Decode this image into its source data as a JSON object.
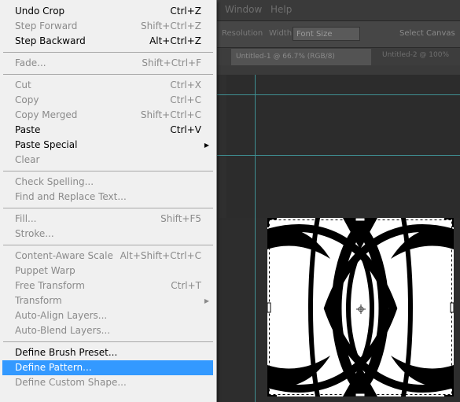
{
  "background_app": {
    "menubar": [
      "Window",
      "Help"
    ],
    "options_bar": {
      "label": "Resolution",
      "field1": "Width",
      "dropdown": "Font Size",
      "field2": "Select Canvas"
    },
    "doc_tab": {
      "title": "Untitled-1 @ 66.7% (RGB/8)",
      "second": "Untitled-2 @ 100%"
    }
  },
  "edit_menu": {
    "groups": [
      [
        {
          "label": "Undo Crop",
          "shortcut": "Ctrl+Z",
          "enabled": true
        },
        {
          "label": "Step Forward",
          "shortcut": "Shift+Ctrl+Z",
          "enabled": false
        },
        {
          "label": "Step Backward",
          "shortcut": "Alt+Ctrl+Z",
          "enabled": true
        }
      ],
      [
        {
          "label": "Fade...",
          "shortcut": "Shift+Ctrl+F",
          "enabled": false
        }
      ],
      [
        {
          "label": "Cut",
          "shortcut": "Ctrl+X",
          "enabled": false
        },
        {
          "label": "Copy",
          "shortcut": "Ctrl+C",
          "enabled": false
        },
        {
          "label": "Copy Merged",
          "shortcut": "Shift+Ctrl+C",
          "enabled": false
        },
        {
          "label": "Paste",
          "shortcut": "Ctrl+V",
          "enabled": true
        },
        {
          "label": "Paste Special",
          "shortcut": "",
          "enabled": true,
          "submenu": true
        },
        {
          "label": "Clear",
          "shortcut": "",
          "enabled": false
        }
      ],
      [
        {
          "label": "Check Spelling...",
          "shortcut": "",
          "enabled": false
        },
        {
          "label": "Find and Replace Text...",
          "shortcut": "",
          "enabled": false
        }
      ],
      [
        {
          "label": "Fill...",
          "shortcut": "Shift+F5",
          "enabled": false
        },
        {
          "label": "Stroke...",
          "shortcut": "",
          "enabled": false
        }
      ],
      [
        {
          "label": "Content-Aware Scale",
          "shortcut": "Alt+Shift+Ctrl+C",
          "enabled": false
        },
        {
          "label": "Puppet Warp",
          "shortcut": "",
          "enabled": false
        },
        {
          "label": "Free Transform",
          "shortcut": "Ctrl+T",
          "enabled": false
        },
        {
          "label": "Transform",
          "shortcut": "",
          "enabled": false,
          "submenu": true
        },
        {
          "label": "Auto-Align Layers...",
          "shortcut": "",
          "enabled": false
        },
        {
          "label": "Auto-Blend Layers...",
          "shortcut": "",
          "enabled": false
        }
      ],
      [
        {
          "label": "Define Brush Preset...",
          "shortcut": "",
          "enabled": true
        },
        {
          "label": "Define Pattern...",
          "shortcut": "",
          "enabled": true,
          "selected": true
        },
        {
          "label": "Define Custom Shape...",
          "shortcut": "",
          "enabled": false
        }
      ]
    ],
    "submenu_arrow_icon": "triangle-right-icon",
    "colors": {
      "background": "#f0f0f0",
      "text": "#000000",
      "disabled": "#8a8a8a",
      "selection": "#3399ff"
    }
  }
}
